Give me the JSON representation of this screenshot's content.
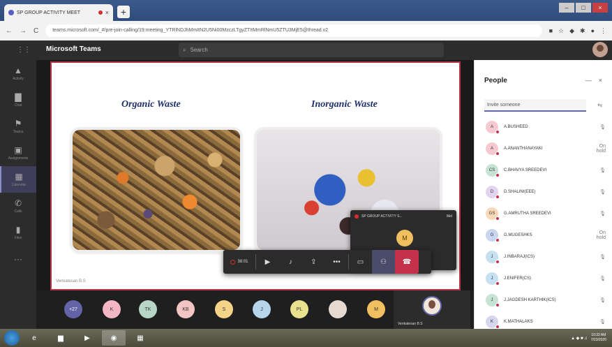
{
  "browser": {
    "tab_title": "SP GROUP ACTIVITY MEET",
    "new_tab": "+",
    "url": "teams.microsoft.com/_#/pre-join-calling/19:meeting_YTRlNDJhMmItN2U5Ni00MzczLTgyZTItMmRlNmU5ZTU3MjE5@thread.v2",
    "back": "←",
    "forward": "→",
    "reload": "C"
  },
  "teams": {
    "app_title": "Microsoft Teams",
    "search_placeholder": "Search"
  },
  "rail": [
    {
      "icon": "bell-icon",
      "glyph": "▲",
      "label": "Activity"
    },
    {
      "icon": "chat-icon",
      "glyph": "▇",
      "label": "Chat"
    },
    {
      "icon": "teams-icon",
      "glyph": "⚑",
      "label": "Teams"
    },
    {
      "icon": "assignments-icon",
      "glyph": "▣",
      "label": "Assignments"
    },
    {
      "icon": "calendar-icon",
      "glyph": "▦",
      "label": "Calendar"
    },
    {
      "icon": "calls-icon",
      "glyph": "✆",
      "label": "Calls"
    },
    {
      "icon": "files-icon",
      "glyph": "▮",
      "label": "Files"
    },
    {
      "icon": "more-apps-icon",
      "glyph": "···",
      "label": ""
    }
  ],
  "slide": {
    "heading_left": "Organic Waste",
    "heading_right": "Inorganic Waste",
    "presenter": "Venkatesan B.S"
  },
  "mini_window": {
    "title": "SP GROUP ACTIVITY S...",
    "status": "Mel",
    "avatar_initial": "M"
  },
  "controls": {
    "timer": "38:01"
  },
  "participants": [
    {
      "initials": "+27",
      "color": "#6264a7",
      "text_color": "#ffffff"
    },
    {
      "initials": "K",
      "color": "#f4b6c2",
      "text_color": "#333333"
    },
    {
      "initials": "TK",
      "color": "#b7d6c8",
      "text_color": "#333333"
    },
    {
      "initials": "KB",
      "color": "#f2c4c4",
      "text_color": "#333333"
    },
    {
      "initials": "S",
      "color": "#f5d48a",
      "text_color": "#333333"
    },
    {
      "initials": "J",
      "color": "#b6d4ea",
      "text_color": "#333333"
    },
    {
      "initials": "PL",
      "color": "#e9e18f",
      "text_color": "#333333"
    },
    {
      "initials": "",
      "color": "#e6d9d0",
      "text_color": "#333333"
    },
    {
      "initials": "M",
      "color": "#f0c060",
      "text_color": "#333333"
    }
  ],
  "self_tile": {
    "name": "Venkatesan B.S"
  },
  "people_panel": {
    "title": "People",
    "invite_placeholder": "Invite someone",
    "rows": [
      {
        "initials": "A",
        "name": "A.BUSHEED",
        "status": "",
        "color": "#f6c9d1"
      },
      {
        "initials": "A",
        "name": "A.ANANTHANAYAKI",
        "status": "On hold",
        "color": "#f6c9d1"
      },
      {
        "initials": "CS",
        "name": "C.BHAVYA SREEDEVI",
        "status": "",
        "color": "#c6e3d5"
      },
      {
        "initials": "D",
        "name": "D.SHALINI(EEE)",
        "status": "",
        "color": "#e2d4f0"
      },
      {
        "initials": "GS",
        "name": "G.AMRUTHA SREEDEVI",
        "status": "",
        "color": "#f9d9b8"
      },
      {
        "initials": "G",
        "name": "G.MUGESHKS",
        "status": "On hold",
        "color": "#c8d6f0"
      },
      {
        "initials": "J",
        "name": "J.INBARAJ(ICS)",
        "status": "",
        "color": "#c5e0f0"
      },
      {
        "initials": "J",
        "name": "J.ENIFER(CS)",
        "status": "",
        "color": "#c5e0f0"
      },
      {
        "initials": "J",
        "name": "J.JAGDESH KARTHIK(ICS)",
        "status": "",
        "color": "#c6e3d5"
      },
      {
        "initials": "K",
        "name": "K.MATHALAKS",
        "status": "",
        "color": "#d6d6ee"
      }
    ]
  },
  "taskbar": {
    "time": "10:33 AM",
    "date": "7/23/2020"
  }
}
